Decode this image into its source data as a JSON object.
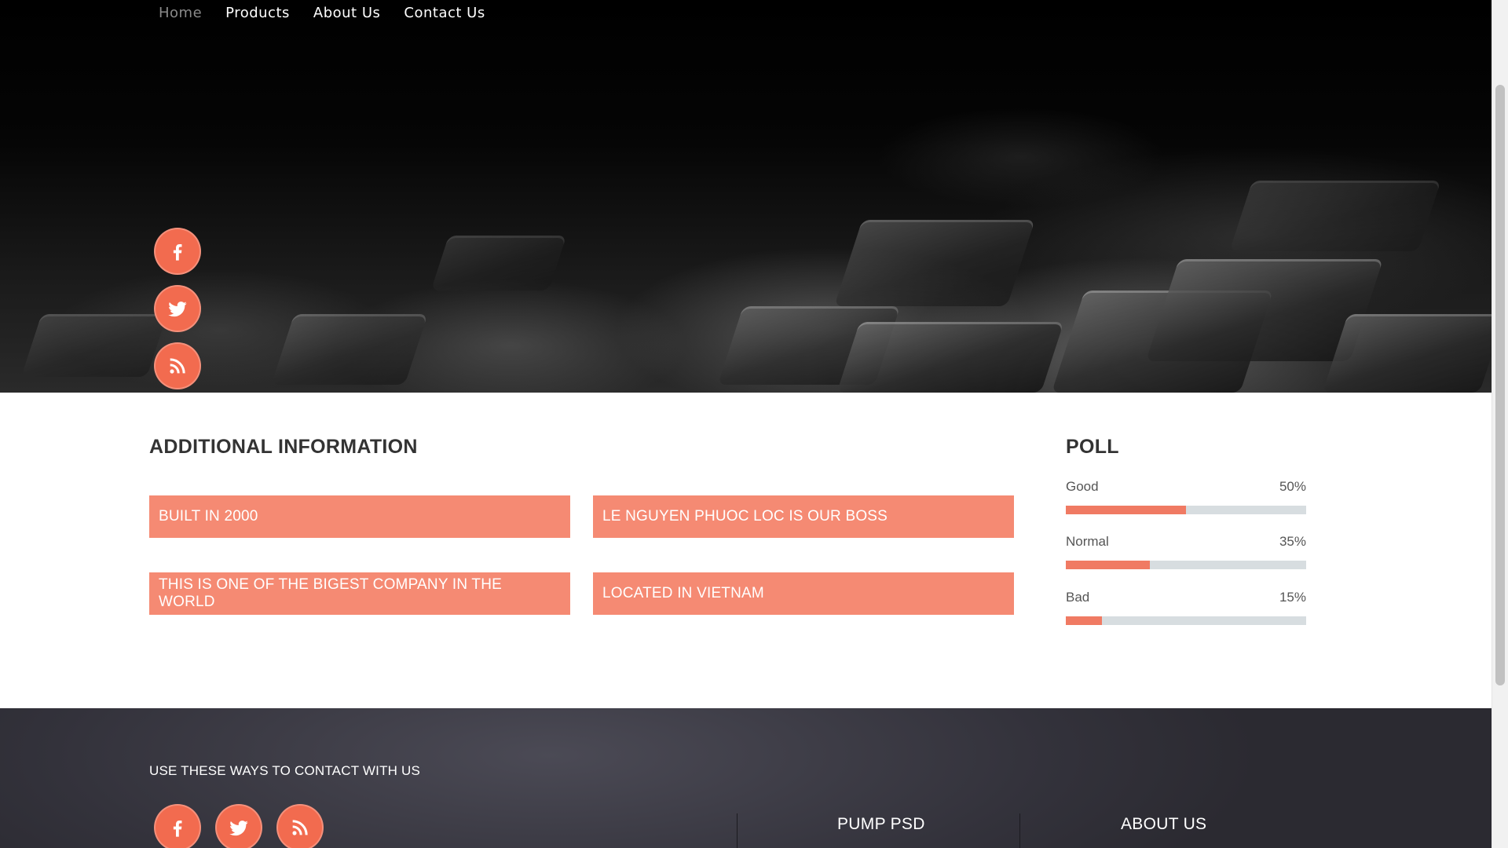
{
  "nav": {
    "items": [
      {
        "label": "Home",
        "active": true
      },
      {
        "label": "Products",
        "active": false
      },
      {
        "label": "About Us",
        "active": false
      },
      {
        "label": "Contact Us",
        "active": false
      }
    ]
  },
  "hero": {
    "social_icons": [
      "facebook-icon",
      "twitter-icon",
      "rss-icon"
    ]
  },
  "additional_info": {
    "title": "ADDITIONAL INFORMATION",
    "items": [
      "BUILT IN 2000",
      "LE NGUYEN PHUOC LOC IS OUR BOSS",
      "THIS IS ONE OF THE BIGEST COMPANY IN THE WORLD",
      "LOCATED IN VIETNAM"
    ]
  },
  "poll": {
    "title": "POLL",
    "options": [
      {
        "label": "Good",
        "value_text": "50%",
        "fraction": 0.5
      },
      {
        "label": "Normal",
        "value_text": "35%",
        "fraction": 0.35
      },
      {
        "label": "Bad",
        "value_text": "15%",
        "fraction": 0.15
      }
    ]
  },
  "footer": {
    "contact_heading": "USE THESE WAYS TO CONTACT WITH US",
    "social_icons": [
      "facebook-icon",
      "twitter-icon",
      "rss-icon"
    ],
    "columns": [
      "PUMP PSD",
      "ABOUT US"
    ]
  },
  "colors": {
    "accent": "#f26b4f",
    "info_box": "#f58a73",
    "poll_fill": "#f07a63",
    "poll_track": "#d7dde0",
    "footer_bg": "#33323b"
  }
}
